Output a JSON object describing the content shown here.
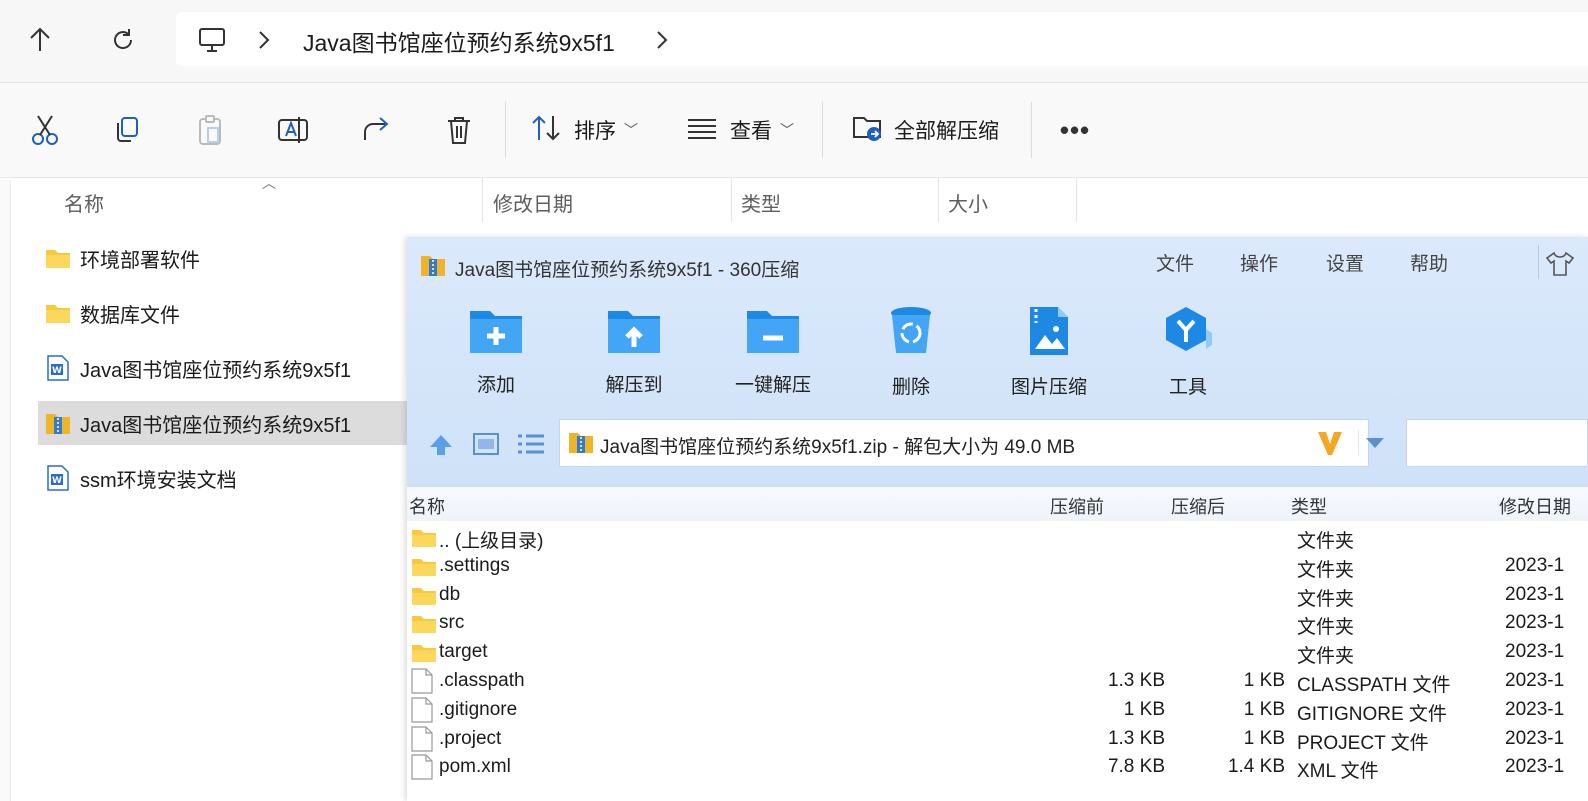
{
  "explorer": {
    "breadcrumb": "Java图书馆座位预约系统9x5f1",
    "toolbar": {
      "sort_label": "排序",
      "view_label": "查看",
      "extract_all_label": "全部解压缩"
    },
    "columns": [
      "名称",
      "修改日期",
      "类型",
      "大小"
    ],
    "files": [
      {
        "name": "环境部署软件",
        "icon": "folder-icon"
      },
      {
        "name": "数据库文件",
        "icon": "folder-icon"
      },
      {
        "name": "Java图书馆座位预约系统9x5f1",
        "icon": "word-doc-icon"
      },
      {
        "name": "Java图书馆座位预约系统9x5f1",
        "icon": "zip-archive-icon",
        "selected": true
      },
      {
        "name": "ssm环境安装文档",
        "icon": "word-doc-icon"
      }
    ]
  },
  "archiver": {
    "title": "Java图书馆座位预约系统9x5f1 - 360压缩",
    "menu": [
      "文件",
      "操作",
      "设置",
      "帮助"
    ],
    "actions": [
      {
        "label": "添加",
        "icon": "add-folder-icon"
      },
      {
        "label": "解压到",
        "icon": "extract-to-icon"
      },
      {
        "label": "一键解压",
        "icon": "one-click-extract-icon"
      },
      {
        "label": "删除",
        "icon": "recycle-delete-icon"
      },
      {
        "label": "图片压缩",
        "icon": "image-compress-icon"
      },
      {
        "label": "工具",
        "icon": "tools-icon"
      }
    ],
    "path_text": "Java图书馆座位预约系统9x5f1.zip - 解包大小为 49.0 MB",
    "columns": [
      "名称",
      "压缩前",
      "压缩后",
      "类型",
      "修改日期"
    ],
    "rows": [
      {
        "name": ".. (上级目录)",
        "before": "",
        "after": "",
        "type": "文件夹",
        "date": "",
        "icon": "folder"
      },
      {
        "name": ".settings",
        "before": "",
        "after": "",
        "type": "文件夹",
        "date": "2023-1",
        "icon": "folder"
      },
      {
        "name": "db",
        "before": "",
        "after": "",
        "type": "文件夹",
        "date": "2023-1",
        "icon": "folder"
      },
      {
        "name": "src",
        "before": "",
        "after": "",
        "type": "文件夹",
        "date": "2023-1",
        "icon": "folder"
      },
      {
        "name": "target",
        "before": "",
        "after": "",
        "type": "文件夹",
        "date": "2023-1",
        "icon": "folder"
      },
      {
        "name": ".classpath",
        "before": "1.3 KB",
        "after": "1 KB",
        "type": "CLASSPATH 文件",
        "date": "2023-1",
        "icon": "file"
      },
      {
        "name": ".gitignore",
        "before": "1 KB",
        "after": "1 KB",
        "type": "GITIGNORE 文件",
        "date": "2023-1",
        "icon": "file"
      },
      {
        "name": ".project",
        "before": "1.3 KB",
        "after": "1 KB",
        "type": "PROJECT 文件",
        "date": "2023-1",
        "icon": "file"
      },
      {
        "name": "pom.xml",
        "before": "7.8 KB",
        "after": "1.4 KB",
        "type": "XML 文件",
        "date": "2023-1",
        "icon": "file"
      }
    ]
  }
}
